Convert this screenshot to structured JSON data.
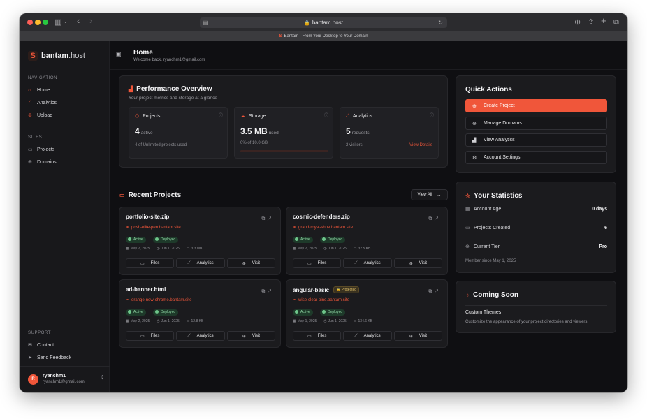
{
  "browser": {
    "url": "bantam.host",
    "tab_title": "Bantam - From Your Desktop to Your Domain"
  },
  "sidebar": {
    "brand": {
      "logo": "S",
      "name_bold": "bantam",
      "name_thin": ".host"
    },
    "sections": {
      "navigation": "NAVIGATION",
      "sites": "SITES",
      "support": "SUPPORT"
    },
    "nav": [
      {
        "label": "Home",
        "icon": "home-icon",
        "active": true
      },
      {
        "label": "Analytics",
        "icon": "analytics-icon"
      },
      {
        "label": "Upload",
        "icon": "upload-icon"
      }
    ],
    "sites": [
      {
        "label": "Projects",
        "icon": "folder-icon"
      },
      {
        "label": "Domains",
        "icon": "globe-icon"
      }
    ],
    "support": [
      {
        "label": "Contact",
        "icon": "mail-icon"
      },
      {
        "label": "Send Feedback",
        "icon": "send-icon"
      }
    ],
    "user": {
      "initial": "R",
      "name": "ryanchm1",
      "email": "ryanchm1@gmail.com"
    }
  },
  "header": {
    "title": "Home",
    "subtitle": "Welcome back, ryanchm1@gmail.com"
  },
  "performance": {
    "title": "Performance Overview",
    "subtitle": "Your project metrics and storage at a glance",
    "projects": {
      "label": "Projects",
      "value": "4",
      "unit": "active",
      "footer": "4 of Unlimited projects used"
    },
    "storage": {
      "label": "Storage",
      "value": "3.5 MB",
      "unit": "used",
      "footer": "0% of 10.0 GB",
      "percent": 0
    },
    "analytics": {
      "label": "Analytics",
      "value": "5",
      "unit": "requests",
      "footer": "2 visitors",
      "link": "View Details"
    }
  },
  "recent": {
    "title": "Recent Projects",
    "view_all": "View All",
    "actions": {
      "files": "Files",
      "analytics": "Analytics",
      "visit": "Visit"
    },
    "status": {
      "active": "Active",
      "deployed": "Deployed"
    },
    "projects": [
      {
        "name": "portfolio-site.zip",
        "link": "posh-elite-pen.bantam.site",
        "created": "May 2, 2025",
        "updated": "Jun 1, 2025",
        "size": "3.3 MB"
      },
      {
        "name": "cosmic-defenders.zip",
        "link": "grand-royal-shoe.bantam.site",
        "created": "May 2, 2025",
        "updated": "Jun 1, 2025",
        "size": "32.5 KB"
      },
      {
        "name": "ad-banner.html",
        "link": "orange-new-chrome.bantam.site",
        "created": "May 2, 2025",
        "updated": "Jun 1, 2025",
        "size": "12.8 KB"
      },
      {
        "name": "angular-basic",
        "badge": "Protected",
        "link": "wise-clear-pine.bantam.site",
        "created": "May 1, 2025",
        "updated": "Jun 1, 2025",
        "size": "134.6 KB"
      }
    ]
  },
  "quick_actions": {
    "title": "Quick Actions",
    "buttons": [
      {
        "label": "Create Project",
        "icon": "plus-circle-icon"
      },
      {
        "label": "Manage Domains",
        "icon": "globe-icon"
      },
      {
        "label": "View Analytics",
        "icon": "chart-icon"
      },
      {
        "label": "Account Settings",
        "icon": "settings-icon"
      }
    ]
  },
  "statistics": {
    "title": "Your Statistics",
    "rows": [
      {
        "label": "Account Age",
        "value": "0 days"
      },
      {
        "label": "Projects Created",
        "value": "6"
      },
      {
        "label": "Current Tier",
        "value": "Pro"
      }
    ],
    "footer": "Member since May 1, 2025"
  },
  "coming_soon": {
    "title": "Coming Soon",
    "feature_title": "Custom Themes",
    "feature_desc": "Customize the appearance of your project directories and viewers."
  },
  "colors": {
    "accent": "#f0563a",
    "background": "#0f0f12",
    "card": "#1b1b1e",
    "success": "#6ec58a"
  }
}
